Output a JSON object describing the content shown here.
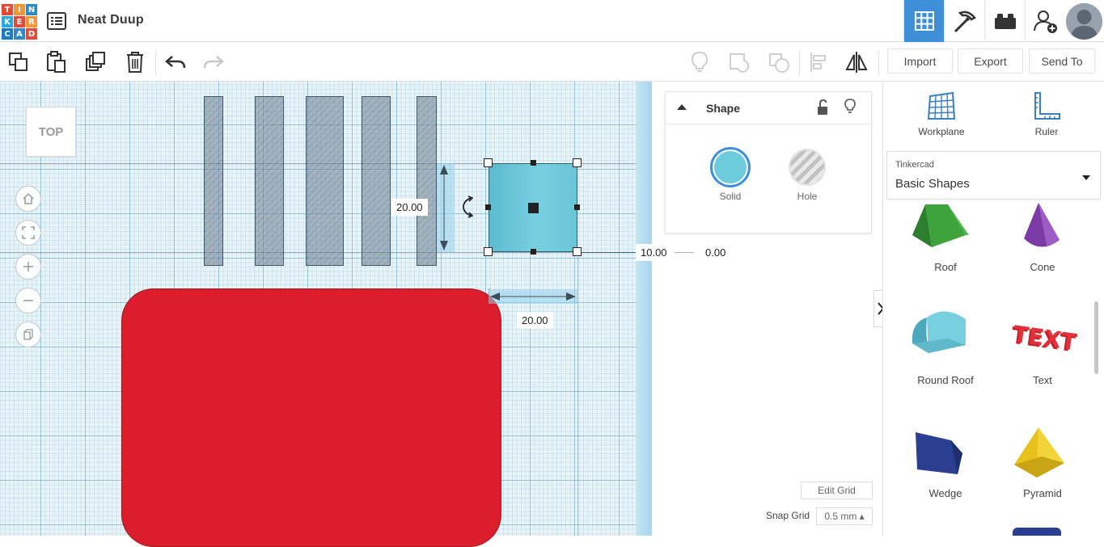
{
  "header": {
    "logo_letters": [
      "T",
      "I",
      "N",
      "K",
      "E",
      "R",
      "C",
      "A",
      "D"
    ],
    "logo_colors": [
      "#e24a36",
      "#f2963a",
      "#2d8ac9",
      "#29a9e0",
      "#e24a36",
      "#f2963a",
      "#1b7ac6",
      "#2d8ac9",
      "#e24a36"
    ],
    "design_title": "Neat Duup",
    "views": [
      {
        "name": "3d-design-view",
        "icon": "grid-icon",
        "active": true
      },
      {
        "name": "codeblocks-view",
        "icon": "pickaxe-icon",
        "active": false
      },
      {
        "name": "bricks-view",
        "icon": "brick-icon",
        "active": false
      },
      {
        "name": "add-collaborator",
        "icon": "add-user-icon",
        "active": false
      }
    ]
  },
  "toolbar": {
    "tools": [
      "copy-icon",
      "paste-icon",
      "duplicate-icon",
      "delete-icon",
      "undo-icon",
      "redo-icon"
    ],
    "right_tools": [
      "lightbulb-icon",
      "group-icon",
      "ungroup-icon",
      "align-icon",
      "mirror-icon"
    ],
    "import_label": "Import",
    "export_label": "Export",
    "sendto_label": "Send To"
  },
  "workplane": {
    "viewcube_label": "TOP",
    "nav": [
      "home-icon",
      "fit-view-icon",
      "zoom-in-icon",
      "zoom-out-icon",
      "perspective-icon"
    ],
    "height_dim": "20.00",
    "width_dim": "20.00",
    "elevation_x": "10.00",
    "elevation_y": "0.00",
    "accent": "#3d8fd9"
  },
  "inspector": {
    "title": "Shape",
    "solid_label": "Solid",
    "hole_label": "Hole",
    "solid_color": "#6ccbdd"
  },
  "grid": {
    "edit_grid_label": "Edit Grid",
    "snap_label": "Snap Grid",
    "snap_value": "0.5 mm ▴"
  },
  "rightpanel": {
    "workplane_label": "Workplane",
    "ruler_label": "Ruler",
    "library_caption": "Tinkercad",
    "library_value": "Basic Shapes",
    "shapes": [
      {
        "label": "Roof",
        "icon": "roof-icon"
      },
      {
        "label": "Cone",
        "icon": "cone-icon"
      },
      {
        "label": "Round Roof",
        "icon": "round-roof-icon"
      },
      {
        "label": "Text",
        "icon": "text-shape-icon"
      },
      {
        "label": "Wedge",
        "icon": "wedge-icon"
      },
      {
        "label": "Pyramid",
        "icon": "pyramid-icon"
      }
    ]
  }
}
